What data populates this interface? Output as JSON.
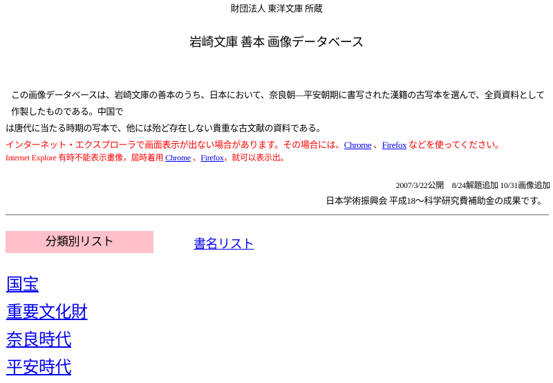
{
  "header": {
    "owner": "財団法人 東洋文庫 所蔵",
    "title": "岩崎文庫 善本 画像データベース"
  },
  "intro": {
    "line1": "この画像データベースは、岩崎文庫の善本のうち、日本において、奈良朝―平安朝期に書写された漢籍の古写本を選んで、全頁資料として作製したものである。中国で",
    "line2": "は唐代に当たる時期の写本で、他には殆ど存在しない貴重な古文献の資料である。"
  },
  "notice_ja": {
    "before": "インターネット・エクスプローラで画面表示が出ない場合があります。その場合には、",
    "chrome": "Chrome",
    "sep": " 、",
    "firefox": "Firefox",
    "after": " などを使ってください。"
  },
  "notice_zh": {
    "before": "Internet Explore 有時不能表示畫像，屆時着用 ",
    "chrome": "Chrome",
    "sep": " 、",
    "firefox": "Firefox",
    "after": "，就可以表示出。"
  },
  "meta": {
    "dates": "2007/3/22公開　8/24解題追加 10/31画像追加",
    "funding": "日本学術振興会 平成18～科学研究費補助金の成果です。"
  },
  "tabs": {
    "category_list": "分類別リスト",
    "title_list": "書名リスト"
  },
  "categories": [
    "国宝",
    "重要文化財",
    "奈良時代",
    "平安時代"
  ],
  "colors": {
    "link": "#0000ee",
    "notice": "#ff0000",
    "active_tab_bg": "#ffc0cb"
  }
}
